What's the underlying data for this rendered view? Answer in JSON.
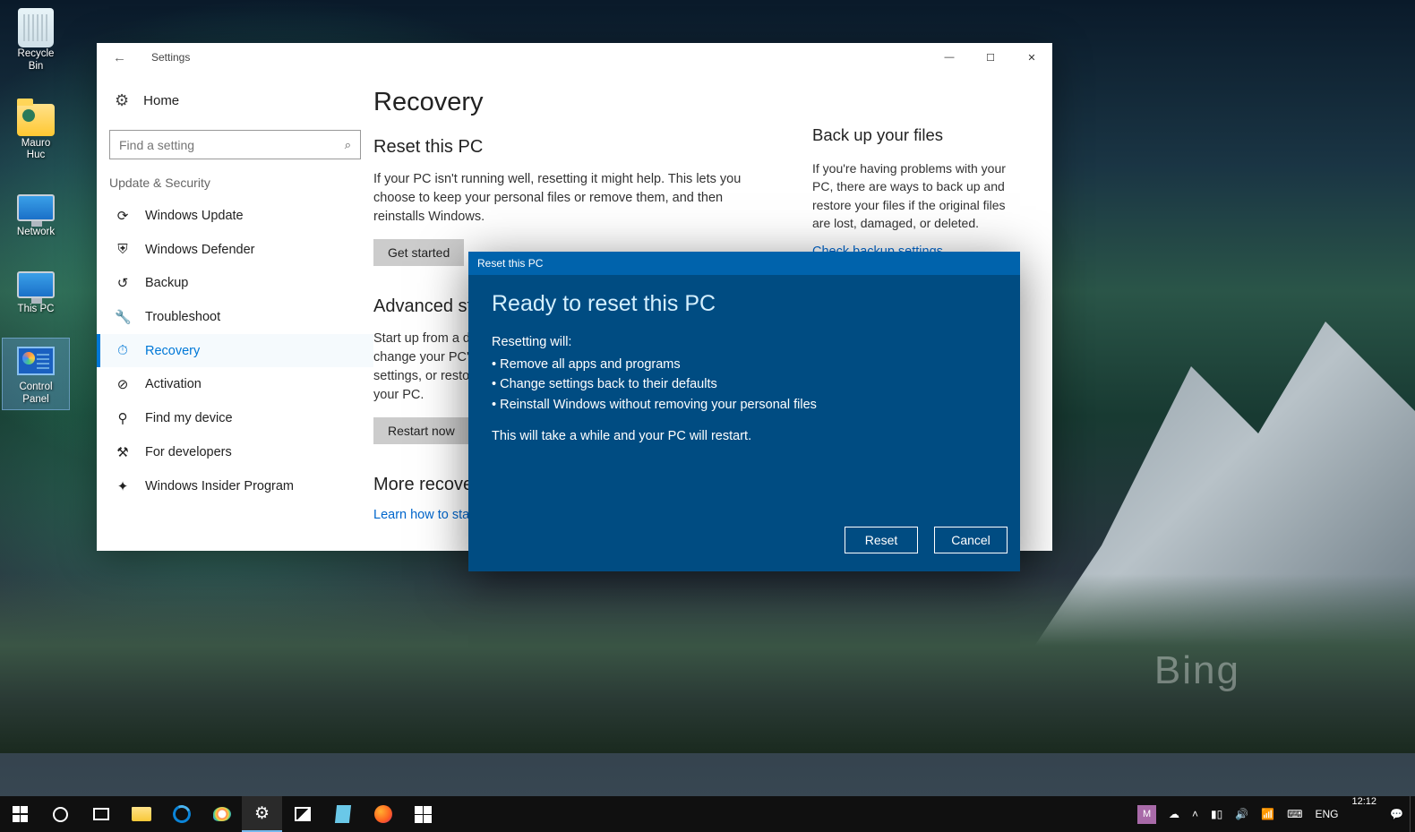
{
  "desktop": {
    "icons": [
      {
        "label": "Recycle\nBin"
      },
      {
        "label": "Mauro\nHuc"
      },
      {
        "label": "Network"
      },
      {
        "label": "This PC"
      },
      {
        "label": "Control\nPanel"
      }
    ],
    "watermark": "Bing"
  },
  "settings_window": {
    "title": "Settings",
    "home_label": "Home",
    "search_placeholder": "Find a setting",
    "category_header": "Update & Security",
    "nav_items": [
      {
        "label": "Windows Update"
      },
      {
        "label": "Windows Defender"
      },
      {
        "label": "Backup"
      },
      {
        "label": "Troubleshoot"
      },
      {
        "label": "Recovery"
      },
      {
        "label": "Activation"
      },
      {
        "label": "Find my device"
      },
      {
        "label": "For developers"
      },
      {
        "label": "Windows Insider Program"
      }
    ],
    "page_title": "Recovery",
    "sections": {
      "reset": {
        "heading": "Reset this PC",
        "body": "If your PC isn't running well, resetting it might help. This lets you choose to keep your personal files or remove them, and then reinstalls Windows.",
        "button": "Get started"
      },
      "advanced": {
        "heading": "Advanced startup",
        "body": "Start up from a device or disc (such as a USB drive or DVD), change your PC's firmware settings, change Windows startup settings, or restore Windows from a system image. This will restart your PC.",
        "button": "Restart now"
      },
      "more": {
        "heading": "More recovery options",
        "link": "Learn how to start fresh with a clean installation of Windows"
      }
    },
    "backup_panel": {
      "heading": "Back up your files",
      "body": "If you're having problems with your PC, there are ways to back up and restore your files if the original files are lost, damaged, or deleted.",
      "link": "Check backup settings"
    }
  },
  "reset_dialog": {
    "title": "Reset this PC",
    "heading": "Ready to reset this PC",
    "sub": "Resetting will:",
    "bullets": [
      "Remove all apps and programs",
      "Change settings back to their defaults",
      "Reinstall Windows without removing your personal files"
    ],
    "note": "This will take a while and your PC will restart.",
    "primary": "Reset",
    "secondary": "Cancel"
  },
  "taskbar": {
    "tray_user_initial": "M",
    "lang": "ENG",
    "time": "12:12",
    "date": ""
  }
}
